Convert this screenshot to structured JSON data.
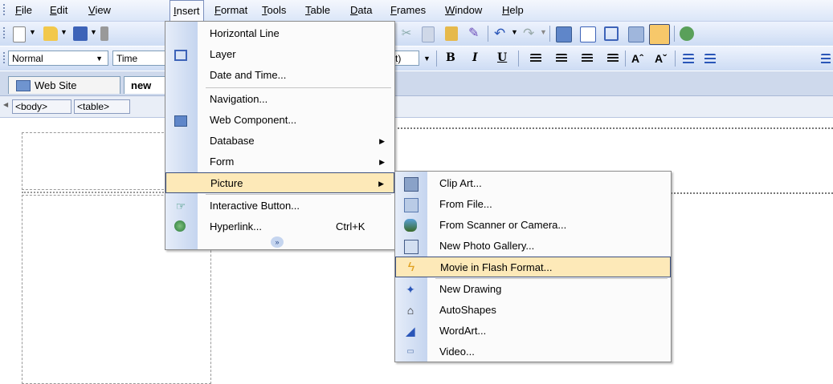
{
  "menubar": {
    "items": [
      "File",
      "Edit",
      "View",
      "Insert",
      "Format",
      "Tools",
      "Table",
      "Data",
      "Frames",
      "Window",
      "Help"
    ]
  },
  "toolbar": {
    "style_value": "Normal",
    "font_value": "Time",
    "size_fragment": "t)",
    "bold": "B",
    "italic": "I",
    "underline": "U"
  },
  "tabs": {
    "web_site": "Web Site",
    "new_page": "new"
  },
  "tag_selector": [
    "<body>",
    "<table>"
  ],
  "insert_menu": {
    "items": [
      {
        "label": "Horizontal Line",
        "icon": "none"
      },
      {
        "label": "Layer",
        "icon": "layer-icon"
      },
      {
        "label": "Date and Time...",
        "icon": "none"
      },
      {
        "label": "Navigation...",
        "icon": "none"
      },
      {
        "label": "Web Component...",
        "icon": "web-component-icon"
      },
      {
        "label": "Database",
        "icon": "none",
        "submenu": true
      },
      {
        "label": "Form",
        "icon": "none",
        "submenu": true
      },
      {
        "label": "Picture",
        "icon": "none",
        "submenu": true,
        "highlighted": true
      },
      {
        "label": "Interactive Button...",
        "icon": "interactive-button-icon"
      },
      {
        "label": "Hyperlink...",
        "icon": "hyperlink-icon",
        "shortcut": "Ctrl+K"
      }
    ],
    "expand_icon": "double-chevron-down-icon"
  },
  "picture_submenu": {
    "items": [
      {
        "label": "Clip Art...",
        "icon": "clip-art-icon"
      },
      {
        "label": "From File...",
        "icon": "from-file-icon"
      },
      {
        "label": "From Scanner or Camera...",
        "icon": "scanner-camera-icon"
      },
      {
        "label": "New Photo Gallery...",
        "icon": "photo-gallery-icon"
      },
      {
        "label": "Movie in Flash Format...",
        "icon": "flash-icon",
        "highlighted": true
      },
      {
        "label": "New Drawing",
        "icon": "new-drawing-icon"
      },
      {
        "label": "AutoShapes",
        "icon": "autoshapes-icon"
      },
      {
        "label": "WordArt...",
        "icon": "wordart-icon"
      },
      {
        "label": "Video...",
        "icon": "video-icon"
      }
    ]
  },
  "colors": {
    "menu_highlight": "#fde9b8",
    "toolbar_blue": "#cddcf4"
  }
}
